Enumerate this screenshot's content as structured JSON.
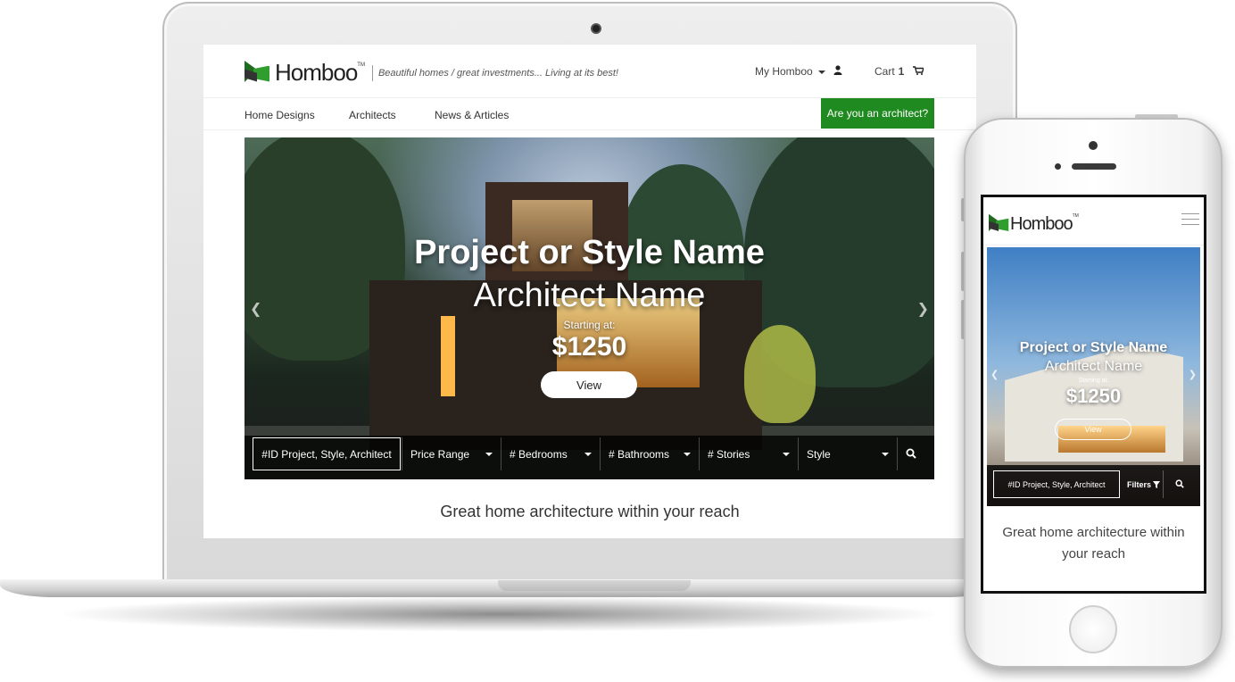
{
  "desktop": {
    "brand": {
      "name": "Homboo",
      "tm": "TM",
      "tagline": "Beautiful homes / great investments... Living at its best!"
    },
    "header": {
      "my_account": "My Homboo",
      "cart_label": "Cart",
      "cart_count": "1"
    },
    "nav": {
      "items": [
        "Home Designs",
        "Architects",
        "News & Articles"
      ],
      "cta": "Are you an architect?"
    },
    "hero": {
      "title": "Project or Style Name",
      "architect": "Architect Name",
      "starting_label": "Starting at:",
      "price": "$1250",
      "view_button": "View"
    },
    "filters": {
      "search_placeholder": "#ID Project, Style, Architect",
      "selects": [
        "Price Range",
        "# Bedrooms",
        "# Bathrooms",
        "# Stories",
        "Style"
      ]
    },
    "tagline": "Great home architecture within your reach"
  },
  "mobile": {
    "brand": {
      "name": "Homboo",
      "tm": "TM"
    },
    "hero": {
      "title": "Project or Style Name",
      "architect": "Architect Name",
      "starting_label": "Starting at:",
      "price": "$1250",
      "view_button": "View"
    },
    "filters": {
      "search_placeholder": "#ID Project, Style, Architect",
      "filters_button": "Filters"
    },
    "tagline": "Great home architecture within your reach"
  },
  "colors": {
    "brand_green": "#1f8a1f",
    "logo_dark_green": "#1f6b1f",
    "logo_green": "#2f9e2f"
  },
  "icons": [
    "user-icon",
    "cart-icon",
    "caret-down-icon",
    "search-icon",
    "filter-icon",
    "hamburger-menu-icon",
    "chevron-left-icon",
    "chevron-right-icon"
  ]
}
